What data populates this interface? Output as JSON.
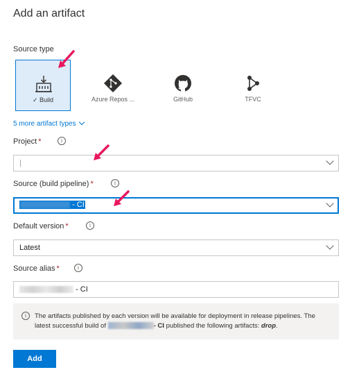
{
  "title": "Add an artifact",
  "source_type_label": "Source type",
  "tiles": [
    {
      "label": "Build",
      "icon": "build-icon",
      "selected": true
    },
    {
      "label": "Azure Repos ...",
      "icon": "azure-repos-icon",
      "selected": false
    },
    {
      "label": "GitHub",
      "icon": "github-icon",
      "selected": false
    },
    {
      "label": "TFVC",
      "icon": "tfvc-icon",
      "selected": false
    }
  ],
  "more_types": "5 more artifact types",
  "project": {
    "label": "Project",
    "value": "|"
  },
  "source": {
    "label": "Source (build pipeline)",
    "value_suffix": "- CI"
  },
  "default_version": {
    "label": "Default version",
    "value": "Latest"
  },
  "source_alias": {
    "label": "Source alias",
    "value_suffix": "- CI"
  },
  "message": {
    "part1": "The artifacts published by each version will be available for deployment in release pipelines. The latest successful build of",
    "name_suffix": "- CI",
    "part2": "published the following artifacts:",
    "artifact": "drop",
    "end": "."
  },
  "add_button": "Add",
  "colors": {
    "accent": "#0078d4",
    "required": "#a4262c",
    "annotation_arrow": "#e8175d"
  }
}
